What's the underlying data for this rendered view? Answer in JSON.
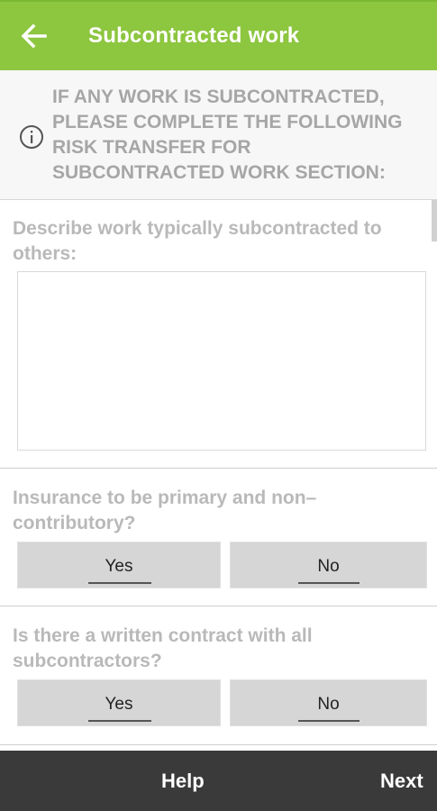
{
  "header": {
    "title": "Subcontracted work",
    "back_icon": "arrow-left-icon",
    "background": "#8dc63f"
  },
  "notice": {
    "icon": "info-icon",
    "text": "IF ANY WORK IS SUBCONTRACTED, PLEASE COMPLETE THE FOLLOWING RISK TRANSFER FOR SUBCONTRACTED WORK SECTION:"
  },
  "description": {
    "label": "Describe work typically subcontracted to others:",
    "value": "",
    "placeholder": ""
  },
  "question1": {
    "label": "Insurance to be primary and non–contributory?",
    "yes_label": "Yes",
    "no_label": "No"
  },
  "question2": {
    "label": "Is there a written contract with all subcontractors?",
    "yes_label": "Yes",
    "no_label": "No"
  },
  "footer": {
    "help_label": "Help",
    "next_label": "Next",
    "background": "#3a3a3a"
  }
}
